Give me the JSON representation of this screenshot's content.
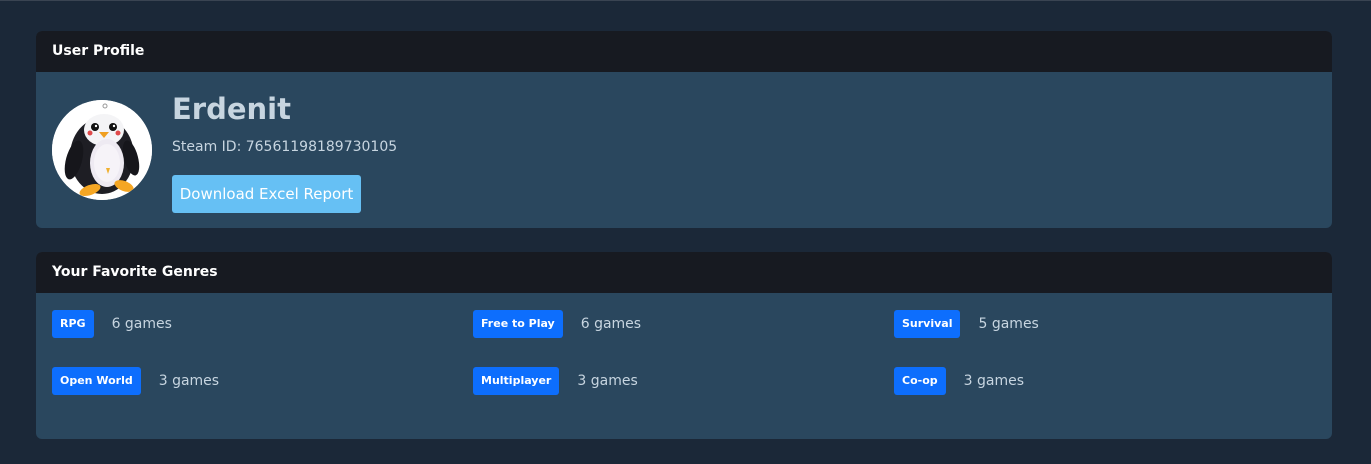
{
  "profile": {
    "header_title": "User Profile",
    "username": "Erdenit",
    "steam_id": "Steam ID: 76561198189730105",
    "download_label": "Download Excel Report"
  },
  "genres": {
    "header_title": "Your Favorite Genres",
    "items": [
      {
        "name": "RPG",
        "count": "6 games"
      },
      {
        "name": "Free to Play",
        "count": "6 games"
      },
      {
        "name": "Survival",
        "count": "5 games"
      },
      {
        "name": "Open World",
        "count": "3 games"
      },
      {
        "name": "Multiplayer",
        "count": "3 games"
      },
      {
        "name": "Co-op",
        "count": "3 games"
      }
    ]
  },
  "colors": {
    "page_background": "#1b2838",
    "card_background": "#2a475e",
    "header_background": "#171a21",
    "button": "#66c0f4",
    "badge": "#0d6efd"
  }
}
